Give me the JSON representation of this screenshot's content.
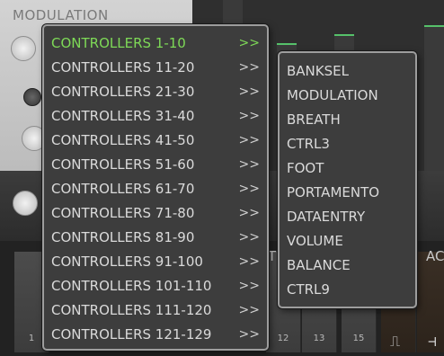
{
  "background": {
    "section_label": "MODULATION",
    "keys": [
      "1",
      "12",
      "13",
      "15"
    ],
    "tabs": [
      "T",
      "AC"
    ],
    "icons": [
      "square-wave-icon",
      "pulse-icon"
    ]
  },
  "controller_menu": {
    "arrow": ">>",
    "active_index": 0,
    "items": [
      "CONTROLLERS 1-10",
      "CONTROLLERS 11-20",
      "CONTROLLERS 21-30",
      "CONTROLLERS 31-40",
      "CONTROLLERS 41-50",
      "CONTROLLERS 51-60",
      "CONTROLLERS 61-70",
      "CONTROLLERS 71-80",
      "CONTROLLERS 81-90",
      "CONTROLLERS 91-100",
      "CONTROLLERS 101-110",
      "CONTROLLERS 111-120",
      "CONTROLLERS 121-129"
    ]
  },
  "submenu": {
    "items": [
      "BANKSEL",
      "MODULATION",
      "BREATH",
      "CTRL3",
      "FOOT",
      "PORTAMENTO",
      "DATAENTRY",
      "VOLUME",
      "BALANCE",
      "CTRL9"
    ]
  },
  "colors": {
    "active_text": "#7ed957",
    "menu_bg": "#3d3d3d",
    "menu_border": "#9d9d9d"
  }
}
